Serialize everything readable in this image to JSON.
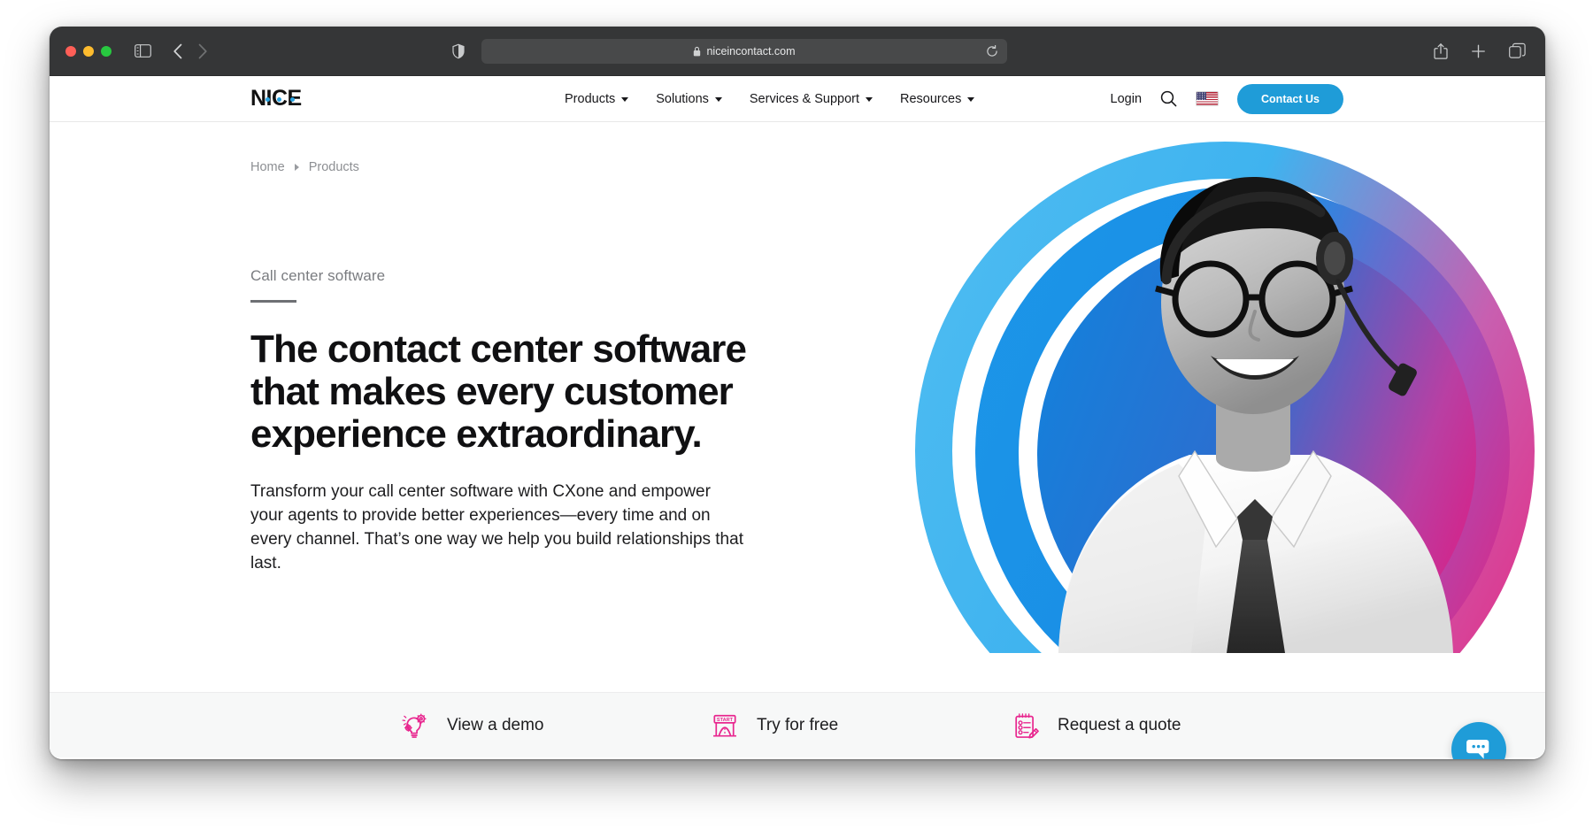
{
  "browser": {
    "traffic_lights": [
      "close",
      "minimize",
      "zoom"
    ],
    "sidebar_toggle_icon": "sidebar-icon",
    "back_icon": "chevron-left-icon",
    "forward_icon": "chevron-right-icon",
    "shield_icon": "shield-icon",
    "lock_icon": "lock-icon",
    "url": "niceincontact.com",
    "reload_icon": "reload-icon",
    "share_icon": "share-icon",
    "new_tab_icon": "plus-icon",
    "tabs_overview_icon": "tabs-overview-icon"
  },
  "site_header": {
    "logo_text": "NICE",
    "logo_accent_color": "#2aa3e0",
    "nav": [
      {
        "label": "Products",
        "has_caret": true
      },
      {
        "label": "Solutions",
        "has_caret": true
      },
      {
        "label": "Services & Support",
        "has_caret": true
      },
      {
        "label": "Resources",
        "has_caret": true
      }
    ],
    "login_label": "Login",
    "search_icon": "search-icon",
    "flag_icon": "us-flag-icon",
    "contact_button_label": "Contact Us",
    "contact_button_color": "#1f9cd8"
  },
  "breadcrumb": {
    "items": [
      "Home",
      "Products"
    ],
    "separator_icon": "chevron-right-icon"
  },
  "hero": {
    "eyebrow": "Call center software",
    "heading": "The contact center software that makes every customer experience extraordinary.",
    "body": "Transform your call center software with CXone and empower your agents to provide better experiences—every time and on every channel. That’s one way we help you build relationships that last.",
    "image_alt": "Smiling call center agent wearing a headset",
    "arc_colors": {
      "blue": "#1c96e8",
      "light_blue": "#4fbdf2",
      "magenta": "#e61e79"
    }
  },
  "cta_strip": {
    "items": [
      {
        "label": "View a demo",
        "icon": "lightbulb-gears-icon"
      },
      {
        "label": "Try for free",
        "icon": "start-gate-icon"
      },
      {
        "label": "Request a quote",
        "icon": "notepad-pencil-icon"
      }
    ],
    "icon_color": "#e8278f"
  },
  "chat_widget": {
    "icon": "chat-bubble-icon",
    "color": "#1f9cd8"
  }
}
